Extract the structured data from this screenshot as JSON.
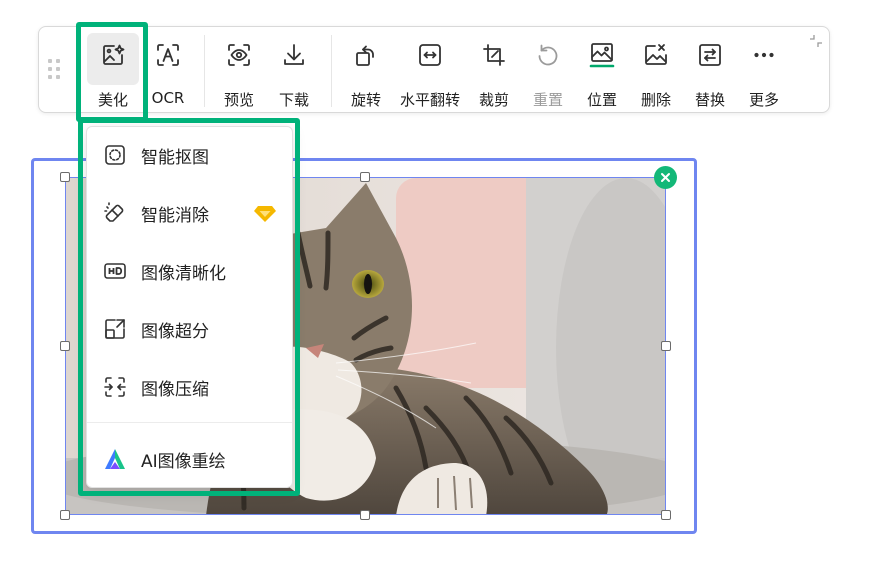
{
  "toolbar": {
    "buttons": [
      {
        "label": "美化",
        "icon": "beautify-icon"
      },
      {
        "label": "OCR",
        "icon": "ocr-icon"
      },
      {
        "label": "预览",
        "icon": "preview-icon"
      },
      {
        "label": "下载",
        "icon": "download-icon"
      },
      {
        "label": "旋转",
        "icon": "rotate-icon"
      },
      {
        "label": "水平翻转",
        "icon": "flip-horizontal-icon"
      },
      {
        "label": "裁剪",
        "icon": "crop-icon"
      },
      {
        "label": "重置",
        "icon": "reset-icon",
        "disabled": true
      },
      {
        "label": "位置",
        "icon": "position-icon"
      },
      {
        "label": "删除",
        "icon": "delete-image-icon"
      },
      {
        "label": "替换",
        "icon": "replace-image-icon"
      },
      {
        "label": "更多",
        "icon": "more-icon"
      }
    ],
    "active": "美化"
  },
  "menu": {
    "items": [
      {
        "label": "智能抠图",
        "icon": "smart-cutout-icon"
      },
      {
        "label": "智能消除",
        "icon": "smart-erase-icon",
        "badge": "premium-diamond-icon"
      },
      {
        "label": "图像清晰化",
        "icon": "hd-icon"
      },
      {
        "label": "图像超分",
        "icon": "super-resolution-icon"
      },
      {
        "label": "图像压缩",
        "icon": "compress-icon"
      },
      {
        "label": "AI图像重绘",
        "icon": "ai-logo-icon"
      }
    ]
  },
  "colors": {
    "highlight": "#00b27a",
    "selection_border": "#6f86f0",
    "close_badge": "#13b878",
    "premium_badge": "#f5b800"
  }
}
